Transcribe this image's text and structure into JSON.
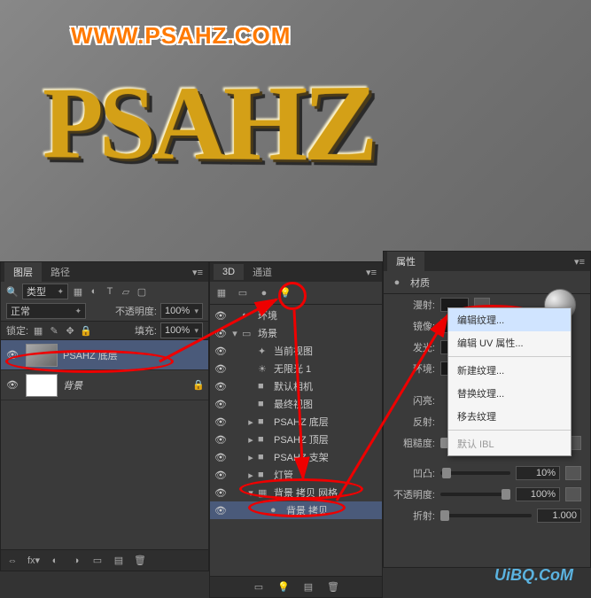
{
  "watermark": "WWW.PSAHZ.COM",
  "text3d": "PSAHZ",
  "uibq": "UiBQ.CoM",
  "layers": {
    "tab1": "图层",
    "tab2": "路径",
    "kind": "类型",
    "blend": "正常",
    "opacity_lbl": "不透明度:",
    "opacity_val": "100%",
    "lock_lbl": "锁定:",
    "fill_lbl": "填充:",
    "fill_val": "100%",
    "items": [
      {
        "name": "PSAHZ 底层",
        "selected": true
      },
      {
        "name": "背景",
        "selected": false
      }
    ]
  },
  "d3": {
    "tab1": "3D",
    "tab2": "通道",
    "items": [
      {
        "indent": 0,
        "tw": "",
        "icon": "◐",
        "name": "环境"
      },
      {
        "indent": 0,
        "tw": "▾",
        "icon": "▭",
        "name": "场景"
      },
      {
        "indent": 1,
        "tw": "",
        "icon": "✦",
        "name": "当前视图"
      },
      {
        "indent": 1,
        "tw": "",
        "icon": "☀",
        "name": "无限光 1"
      },
      {
        "indent": 1,
        "tw": "",
        "icon": "■",
        "name": "默认相机"
      },
      {
        "indent": 1,
        "tw": "",
        "icon": "■",
        "name": "最终视图"
      },
      {
        "indent": 1,
        "tw": "▸",
        "icon": "■",
        "name": "PSAHZ 底层"
      },
      {
        "indent": 1,
        "tw": "▸",
        "icon": "■",
        "name": "PSAHZ 顶层"
      },
      {
        "indent": 1,
        "tw": "▸",
        "icon": "■",
        "name": "PSAHZ 支架"
      },
      {
        "indent": 1,
        "tw": "▸",
        "icon": "■",
        "name": "灯管"
      },
      {
        "indent": 1,
        "tw": "▾",
        "icon": "▦",
        "name": "背景 拷贝 网格",
        "sel": false
      },
      {
        "indent": 2,
        "tw": "",
        "icon": "●",
        "name": "背景 拷贝",
        "sel": true
      }
    ]
  },
  "props": {
    "tab": "属性",
    "header_lbl": "材质",
    "rows": {
      "diffuse": "漫射:",
      "specular": "镜像:",
      "illum": "发光:",
      "ambient": "环境:",
      "shine": "闪亮:",
      "reflect": "反射:",
      "rough": "粗糙度:",
      "bump": "凹凸:",
      "opacity": "不透明度:",
      "refract": "折射:"
    },
    "vals": {
      "rough": "0%",
      "bump": "10%",
      "opacity": "100%",
      "refract": "1.000"
    }
  },
  "context": {
    "edit": "编辑纹理...",
    "uv": "编辑 UV 属性...",
    "new": "新建纹理...",
    "replace": "替换纹理...",
    "remove": "移去纹理",
    "ibl": "默认 IBL"
  }
}
